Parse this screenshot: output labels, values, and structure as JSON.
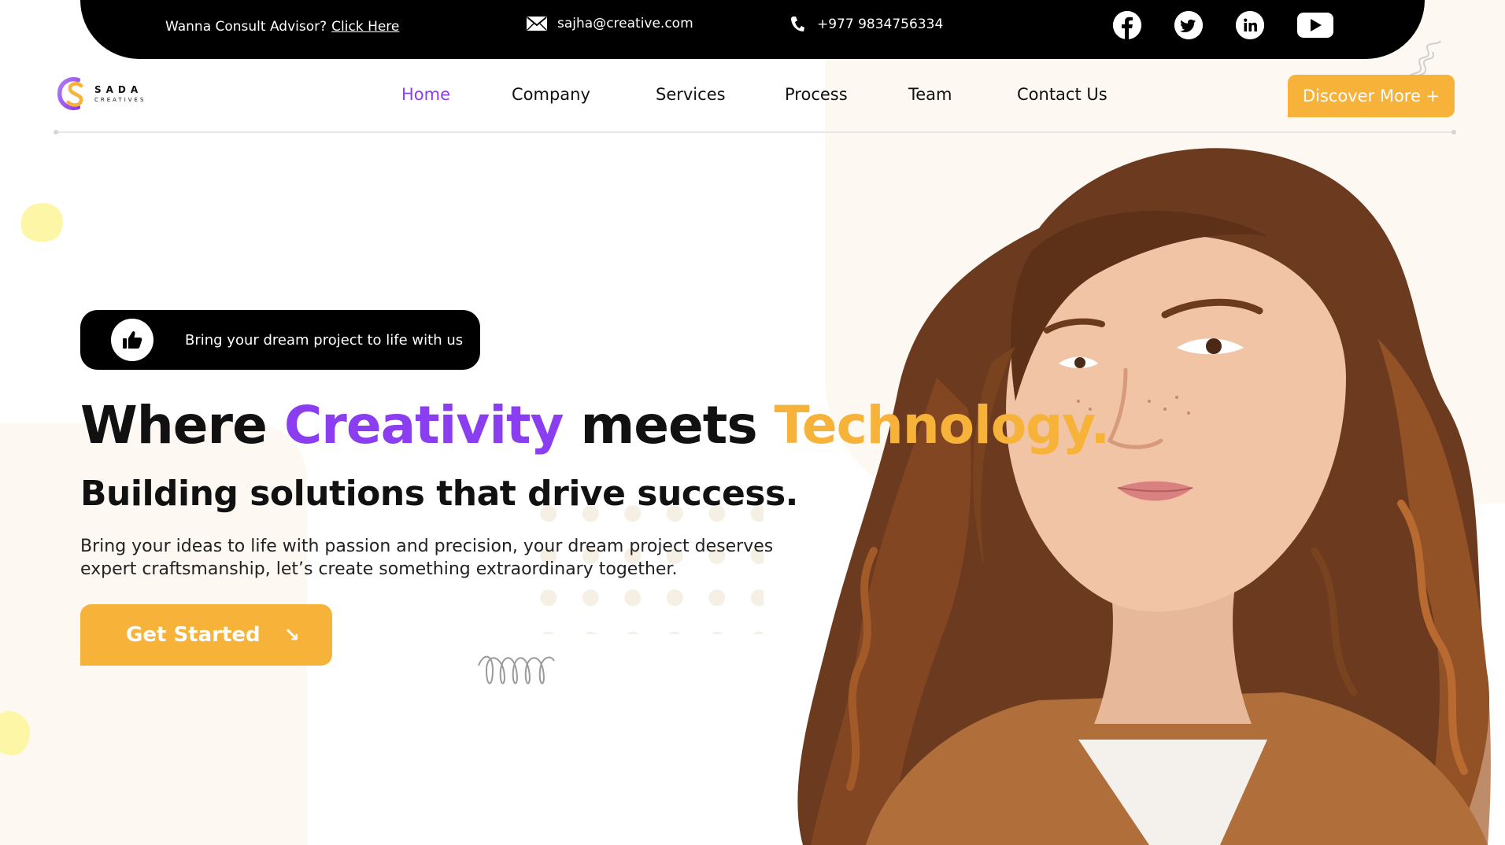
{
  "topbar": {
    "advisor_text": "Wanna Consult Advisor?",
    "advisor_link": "Click Here",
    "email": "sajha@creative.com",
    "phone": "+977 9834756334",
    "socials": [
      {
        "name": "facebook",
        "icon": "facebook-icon"
      },
      {
        "name": "twitter",
        "icon": "twitter-icon"
      },
      {
        "name": "linkedin",
        "icon": "linkedin-icon"
      },
      {
        "name": "youtube",
        "icon": "youtube-icon"
      }
    ]
  },
  "logo": {
    "main": "SADA",
    "sub": "CREATIVES"
  },
  "nav": {
    "items": [
      "Home",
      "Company",
      "Services",
      "Process",
      "Team",
      "Contact Us"
    ],
    "active": "Home",
    "cta": "Discover More +"
  },
  "hero": {
    "pill_text": "Bring your dream project to life with us",
    "headline": {
      "part1": "Where ",
      "part2": "Creativity",
      "part3": " meets ",
      "part4": "Technology."
    },
    "subheadline": "Building solutions that drive success.",
    "description": "Bring your ideas to life with passion and precision, your dream project deserves expert craftsmanship, let’s create something extraordinary together.",
    "cta": "Get Started",
    "cta_icon": "arrow-down-right-icon"
  },
  "colors": {
    "accent_purple": "#8a3ef0",
    "accent_orange": "#f7b239",
    "dark": "#000000",
    "cream": "#fdf8f1"
  }
}
